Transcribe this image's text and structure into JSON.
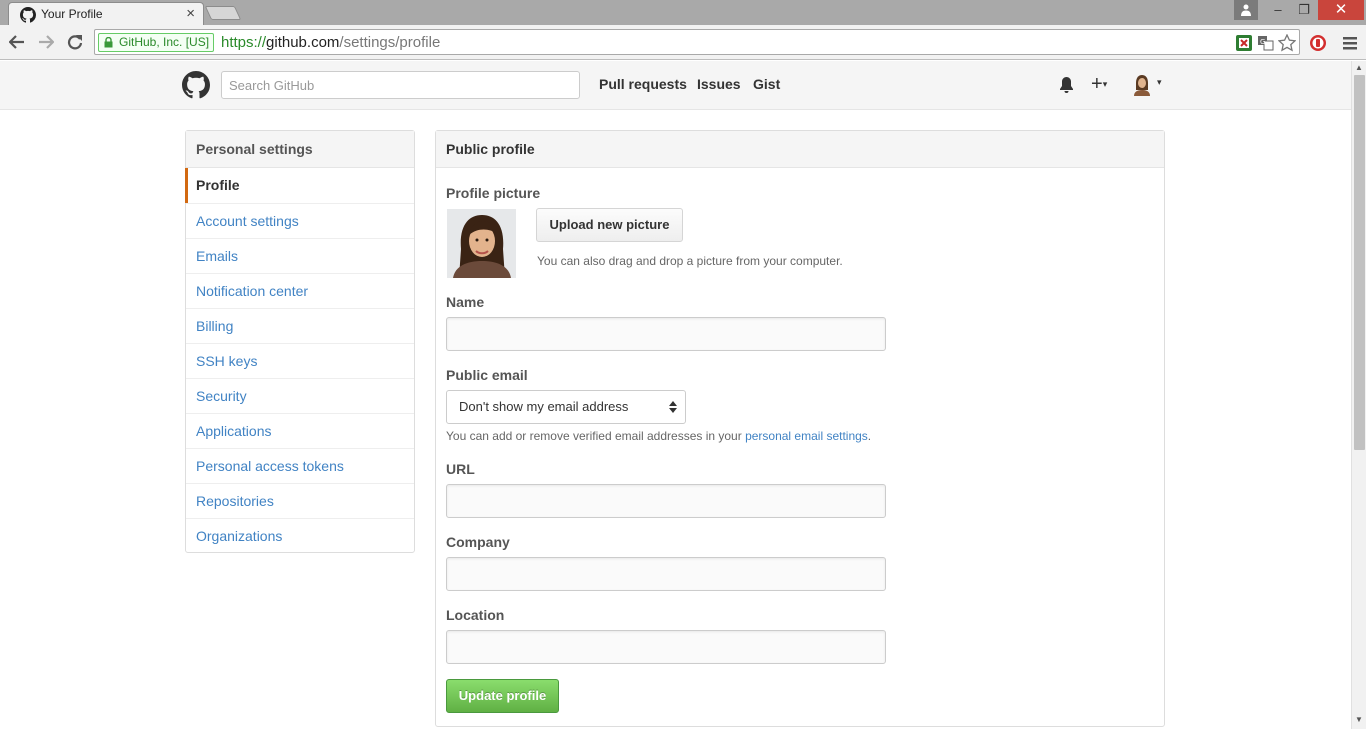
{
  "browser": {
    "tab_title": "Your Profile",
    "tab_close": "×",
    "ev_badge": "GitHub, Inc. [US]",
    "url_scheme": "https://",
    "url_host": "github.com",
    "url_path": "/settings/profile",
    "window_min": "–",
    "window_restore": "❐",
    "window_close": "✕",
    "icons": [
      "back-arrow",
      "forward-arrow",
      "reload",
      "lock",
      "translate",
      "star",
      "extension",
      "adblock",
      "menu"
    ]
  },
  "header": {
    "search_placeholder": "Search GitHub",
    "nav": {
      "pull_requests": "Pull requests",
      "issues": "Issues",
      "gist": "Gist"
    },
    "plus": "+",
    "caret": "▾"
  },
  "sidebar": {
    "title": "Personal settings",
    "items": [
      {
        "label": "Profile",
        "selected": true
      },
      {
        "label": "Account settings"
      },
      {
        "label": "Emails"
      },
      {
        "label": "Notification center"
      },
      {
        "label": "Billing"
      },
      {
        "label": "SSH keys"
      },
      {
        "label": "Security"
      },
      {
        "label": "Applications"
      },
      {
        "label": "Personal access tokens"
      },
      {
        "label": "Repositories"
      },
      {
        "label": "Organizations"
      }
    ]
  },
  "main": {
    "title": "Public profile",
    "profile_picture_label": "Profile picture",
    "upload_button": "Upload new picture",
    "upload_note": "You can also drag and drop a picture from your computer.",
    "name_label": "Name",
    "name_value": "",
    "public_email_label": "Public email",
    "public_email_selected": "Don't show my email address",
    "email_note_prefix": "You can add or remove verified email addresses in your ",
    "email_note_link": "personal email settings",
    "email_note_suffix": ".",
    "url_label": "URL",
    "url_value": "",
    "company_label": "Company",
    "company_value": "",
    "location_label": "Location",
    "location_value": "",
    "update_button": "Update profile"
  },
  "colors": {
    "link": "#4183c4",
    "selected_accent": "#d26911",
    "update_button": "#60b044",
    "window_close": "#c9453c"
  }
}
